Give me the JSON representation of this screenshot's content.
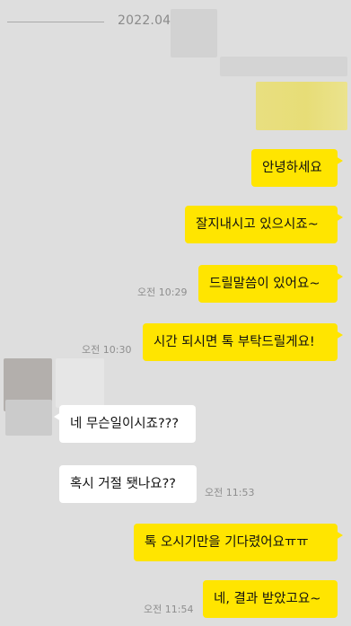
{
  "date_divider": {
    "label": "2022.04."
  },
  "messages": [
    {
      "id": "m1",
      "side": "me",
      "text": "안녕하세요",
      "time": ""
    },
    {
      "id": "m2",
      "side": "me",
      "text": "잘지내시고 있으시죠~",
      "time": ""
    },
    {
      "id": "m3",
      "side": "me",
      "text": "드릴말씀이 있어요~",
      "time": "오전 10:29"
    },
    {
      "id": "m4",
      "side": "me",
      "text": "시간 되시면 톡 부탁드릴게요!",
      "time": "오전 10:30"
    },
    {
      "id": "m5",
      "side": "them",
      "text": "네 무슨일이시죠???",
      "time": ""
    },
    {
      "id": "m6",
      "side": "them",
      "text": "혹시 거절 됏나요??",
      "time": "오전 11:53"
    },
    {
      "id": "m7",
      "side": "me",
      "text": "톡 오시기만을 기다렸어요ㅠㅠ",
      "time": ""
    },
    {
      "id": "m8",
      "side": "me",
      "text": "네, 결과 받았고요~",
      "time": "오전 11:54"
    }
  ],
  "colors": {
    "background": "#dedede",
    "my_bubble": "#ffe500",
    "their_bubble": "#ffffff",
    "timestamp": "#8e8e8e"
  }
}
